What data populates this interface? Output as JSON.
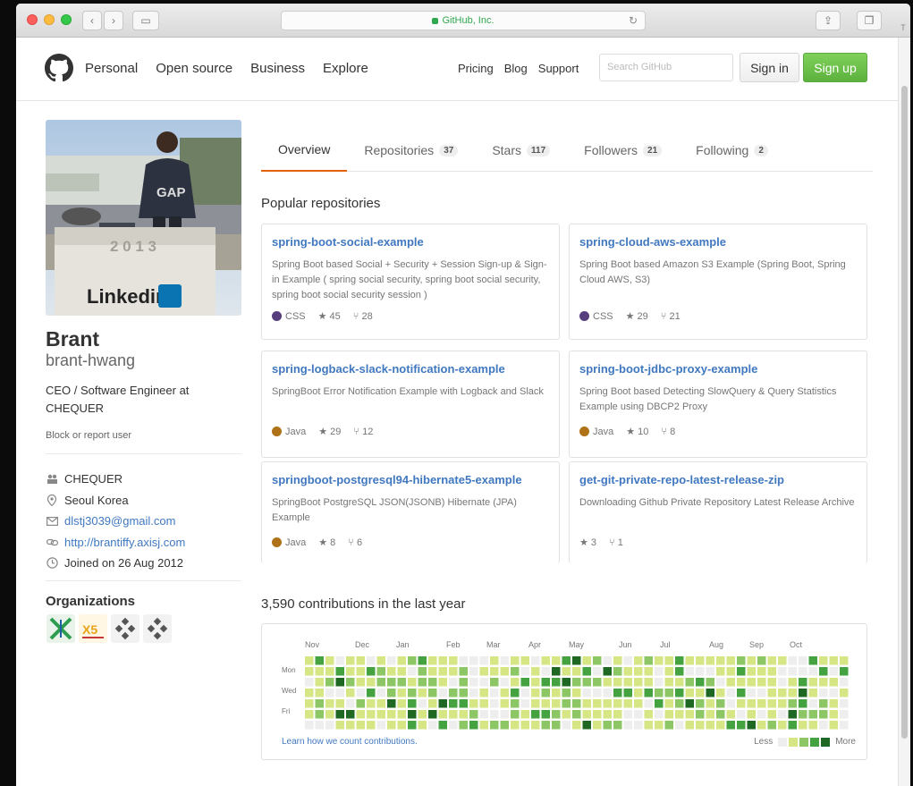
{
  "browser": {
    "url_text": "GitHub, Inc.",
    "tab_glyph": "T"
  },
  "header": {
    "nav": [
      "Personal",
      "Open source",
      "Business",
      "Explore"
    ],
    "right_nav": [
      "Pricing",
      "Blog",
      "Support"
    ],
    "search_placeholder": "Search GitHub",
    "signin_label": "Sign in",
    "signup_label": "Sign up"
  },
  "profile": {
    "avatar_caption": "Linkedin",
    "avatar_sign_text": "2 0 1 3",
    "fullname": "Brant",
    "username": "brant-hwang",
    "bio": "CEO / Software Engineer at CHEQUER",
    "block_label": "Block or report user",
    "details": [
      {
        "icon": "organization-icon",
        "text": "CHEQUER",
        "link": false
      },
      {
        "icon": "location-icon",
        "text": "Seoul Korea",
        "link": false
      },
      {
        "icon": "mail-icon",
        "text": "dlstj3039@gmail.com",
        "link": true
      },
      {
        "icon": "link-icon",
        "text": "http://brantiffy.axisj.com",
        "link": true
      },
      {
        "icon": "clock-icon",
        "text": "Joined on 26 Aug 2012",
        "link": false
      }
    ],
    "organizations_title": "Organizations",
    "organizations": [
      {
        "icon": "axisj-org-icon",
        "glyph": "X",
        "color": "#2e9c4f"
      },
      {
        "icon": "ax5-org-icon",
        "glyph": "X5",
        "color": "#e8a317"
      },
      {
        "icon": "chequer-org-icon",
        "glyph": "◆",
        "color": "#555555"
      },
      {
        "icon": "chequer-dev-org-icon",
        "glyph": "◆",
        "color": "#555555"
      }
    ]
  },
  "tabs": [
    {
      "label": "Overview",
      "count": "",
      "active": true
    },
    {
      "label": "Repositories",
      "count": "37",
      "active": false
    },
    {
      "label": "Stars",
      "count": "117",
      "active": false
    },
    {
      "label": "Followers",
      "count": "21",
      "active": false
    },
    {
      "label": "Following",
      "count": "2",
      "active": false
    }
  ],
  "popular_title": "Popular repositories",
  "repos": [
    {
      "name": "spring-boot-social-example",
      "desc": "Spring Boot based Social + Security + Session Sign-up & Sign-in Example ( spring social security, spring boot social security, spring boot social security session )",
      "lang": "CSS",
      "lang_color": "#563d7c",
      "stars": "45",
      "forks": "28"
    },
    {
      "name": "spring-cloud-aws-example",
      "desc": "Spring Boot based Amazon S3 Example (Spring Boot, Spring Cloud AWS, S3)",
      "lang": "CSS",
      "lang_color": "#563d7c",
      "stars": "29",
      "forks": "21"
    },
    {
      "name": "spring-logback-slack-notification-example",
      "desc": "SpringBoot Error Notification Example with Logback and Slack",
      "lang": "Java",
      "lang_color": "#b07219",
      "stars": "29",
      "forks": "12"
    },
    {
      "name": "spring-boot-jdbc-proxy-example",
      "desc": "Spring Boot based Detecting SlowQuery & Query Statistics Example using DBCP2 Proxy",
      "lang": "Java",
      "lang_color": "#b07219",
      "stars": "10",
      "forks": "8"
    },
    {
      "name": "springboot-postgresql94-hibernate5-example",
      "desc": "SpringBoot PostgreSQL JSON(JSONB) Hibernate (JPA) Example",
      "lang": "Java",
      "lang_color": "#b07219",
      "stars": "8",
      "forks": "6"
    },
    {
      "name": "get-git-private-repo-latest-release-zip",
      "desc": "Downloading Github Private Repository Latest Release Archive",
      "lang": "",
      "lang_color": "",
      "stars": "3",
      "forks": "1"
    }
  ],
  "contributions": {
    "title": "3,590 contributions in the last year",
    "months": [
      "Nov",
      "Dec",
      "Jan",
      "Feb",
      "Mar",
      "Apr",
      "May",
      "Jun",
      "Jul",
      "Aug",
      "Sep",
      "Oct"
    ],
    "weekdays": [
      "Mon",
      "Wed",
      "Fri"
    ],
    "learn_link": "Learn how we count contributions.",
    "legend_less": "Less",
    "legend_more": "More",
    "palette": [
      "#eeeeee",
      "#d6e685",
      "#8cc665",
      "#44a340",
      "#1e6823"
    ]
  }
}
